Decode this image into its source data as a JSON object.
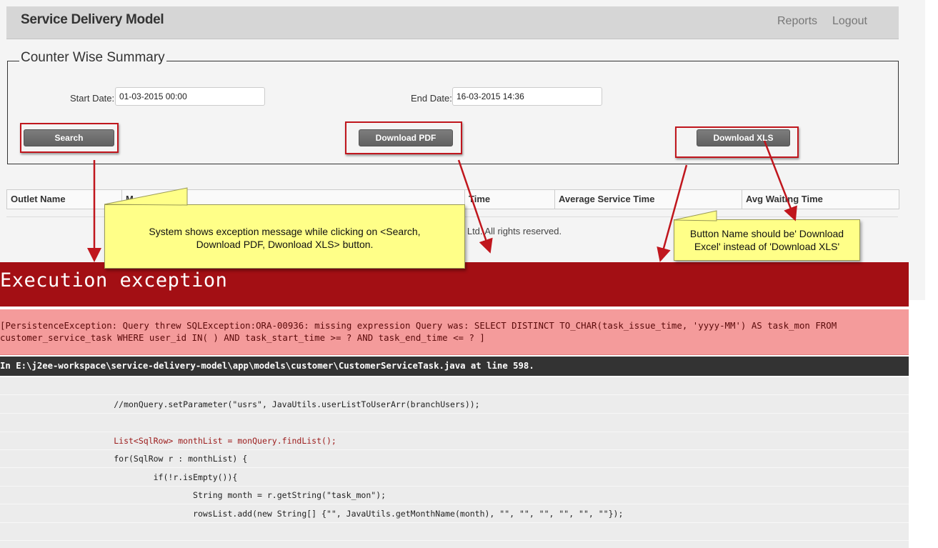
{
  "header": {
    "brand": "Service Delivery Model",
    "nav": [
      "Reports",
      "Logout"
    ]
  },
  "form": {
    "legend": "Counter Wise Summary",
    "start_date_label": "Start Date:",
    "start_date_value": "01-03-2015 00:00",
    "end_date_label": "End Date:",
    "end_date_value": "16-03-2015 14:36",
    "search_label": "Search",
    "pdf_label": "Download PDF",
    "xls_label": "Download XLS"
  },
  "table": {
    "columns": [
      "Outlet Name",
      "M",
      "Time",
      "Average Service Time",
      "Avg Waiting Time"
    ]
  },
  "footer": {
    "text": "ces Ltd. All rights reserved."
  },
  "callouts": {
    "left": "System shows exception message  while clicking on <Search, Download PDF, Dwonload XLS> button.",
    "right": "Button Name should be' Download Excel' instead of 'Download XLS'"
  },
  "exception": {
    "title": "Execution exception",
    "message_line1": "[PersistenceException: Query threw SQLException:ORA-00936: missing expression Query was: SELECT DISTINCT TO_CHAR(task_issue_time, 'yyyy-MM') AS task_mon FROM",
    "message_line2": "customer_service_task WHERE user_id IN( ) AND task_start_time >= ? AND task_end_time <= ? ]",
    "location": "In E:\\j2ee-workspace\\service-delivery-model\\app\\models\\customer\\CustomerServiceTask.java at line 598.",
    "code_lines": [
      "",
      "                       //monQuery.setParameter(\"usrs\", JavaUtils.userListToUserArr(branchUsers));",
      "",
      "                       List<SqlRow> monthList = monQuery.findList();",
      "                       for(SqlRow r : monthList) {",
      "                               if(!r.isEmpty()){",
      "                                       String month = r.getString(\"task_mon\");",
      "                                       rowsList.add(new String[] {\"\", JavaUtils.getMonthName(month), \"\", \"\", \"\", \"\", \"\", \"\"});",
      "",
      ""
    ],
    "error_line_index": 3
  },
  "colors": {
    "annotation_red": "#c0161d",
    "exception_bar": "#a30f14",
    "message_bg": "#f49b9b",
    "callout_yellow": "#ffff88"
  }
}
